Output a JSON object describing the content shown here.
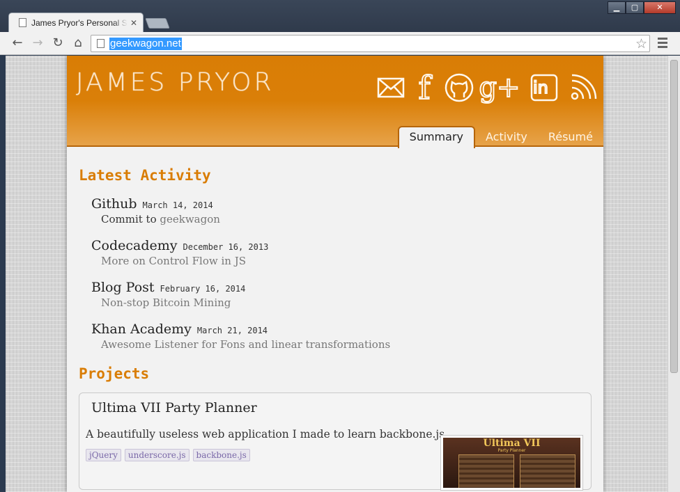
{
  "browser": {
    "tab_title": "James Pryor's Personal Site",
    "url": "geekwagon.net",
    "window_controls": {
      "minimize": "▁",
      "maximize": "▢",
      "close": "✕"
    }
  },
  "site": {
    "name": "JAMES PRYOR",
    "social_icons": [
      "mail-icon",
      "facebook-icon",
      "github-icon",
      "google-plus-icon",
      "linkedin-icon",
      "rss-icon"
    ],
    "social_glyphs": {
      "facebook": "f",
      "google_plus": "g+",
      "linkedin": "in"
    },
    "nav_tabs": [
      {
        "label": "Summary",
        "active": true
      },
      {
        "label": "Activity",
        "active": false
      },
      {
        "label": "Résumé",
        "active": false
      }
    ],
    "accent_color": "#d97d05"
  },
  "latest_activity": {
    "title": "Latest Activity",
    "items": [
      {
        "source": "Github",
        "date": "March 14, 2014",
        "detail_lead": "Commit to",
        "detail": "geekwagon"
      },
      {
        "source": "Codecademy",
        "date": "December 16, 2013",
        "detail_lead": "",
        "detail": "More on Control Flow in JS"
      },
      {
        "source": "Blog Post",
        "date": "February 16, 2014",
        "detail_lead": "",
        "detail": "Non-stop Bitcoin Mining"
      },
      {
        "source": "Khan Academy",
        "date": "March 21, 2014",
        "detail_lead": "",
        "detail": "Awesome Listener for Fons and linear transformations"
      }
    ]
  },
  "projects": {
    "title": "Projects",
    "items": [
      {
        "name": "Ultima VII Party Planner",
        "description": "A beautifully useless web application I made to learn backbone.js.",
        "tags": [
          "jQuery",
          "underscore.js",
          "backbone.js"
        ],
        "thumbnail_title": "Ultima VII",
        "thumbnail_subtitle": "Party Planner"
      }
    ]
  }
}
